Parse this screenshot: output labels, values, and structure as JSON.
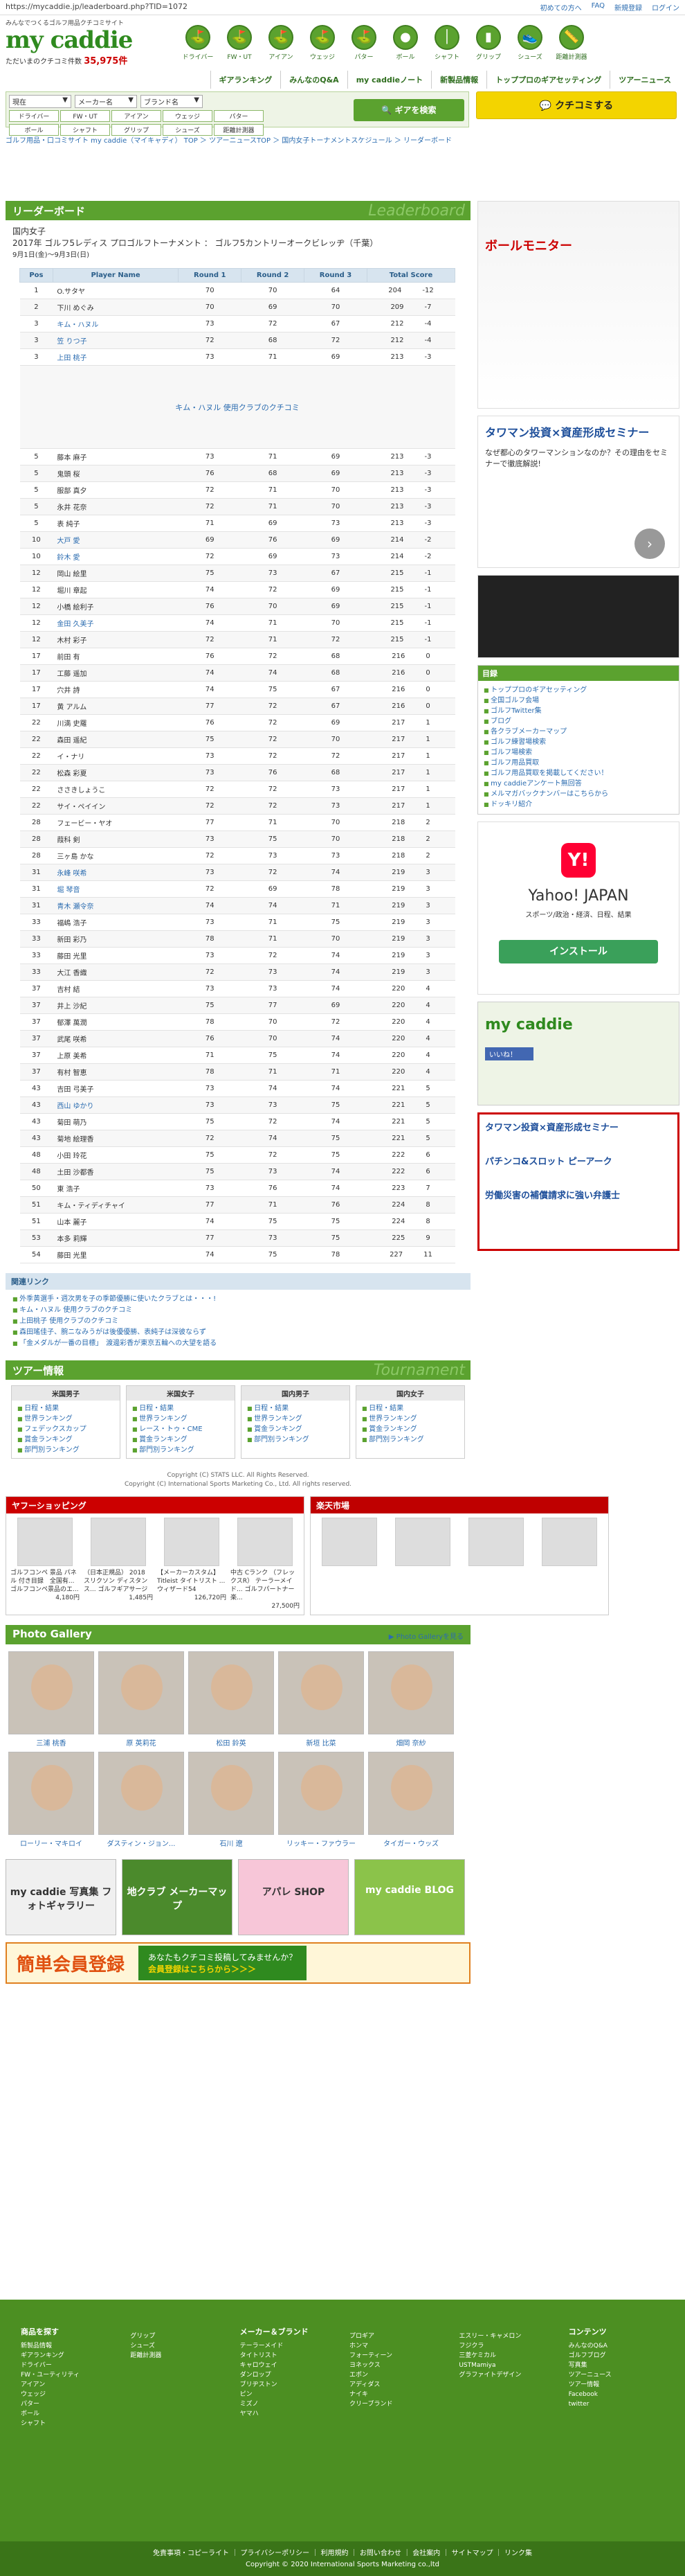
{
  "url": "https://mycaddie.jp/leaderboard.php?TID=1072",
  "top_links": [
    "初めての方へ",
    "FAQ",
    "新規登録",
    "ログイン"
  ],
  "brand": {
    "tagline": "みんなでつくるゴルフ用品クチコミサイト",
    "logo_text": "my caddie",
    "count_label": "ただいまのクチコミ件数",
    "count": "35,975件"
  },
  "categories": [
    "ドライバー",
    "FW・UT",
    "アイアン",
    "ウェッジ",
    "パター",
    "ボール",
    "シャフト",
    "グリップ",
    "シューズ",
    "距離計測器"
  ],
  "nav": [
    "ギアランキング",
    "みんなのQ&A",
    "my caddieノート",
    "新製品情報",
    "トッププロのギアセッティング",
    "ツアーニュース"
  ],
  "search": {
    "sel1": "現在",
    "sel2": "メーカー名",
    "sel3": "ブランド名",
    "chips1": [
      "ドライバー",
      "FW・UT",
      "アイアン",
      "ウェッジ",
      "パター"
    ],
    "chips2": [
      "ボール",
      "シャフト",
      "グリップ",
      "シューズ",
      "距離計測器"
    ],
    "button": "ギアを検索"
  },
  "review_button": "クチコミする",
  "breadcrumb": "ゴルフ用品・口コミサイト my caddie（マイキャディ） TOP ＞ ツアーニュースTOP ＞ 国内女子トーナメントスケジュール ＞ リーダーボード",
  "leaderboard": {
    "title": "リーダーボード",
    "ghost": "Leaderboard",
    "tour": "国内女子",
    "event": "2017年 ゴルフ5レディス プロゴルフトーナメント ： ゴルフ5カントリーオークビレッヂ（千葉）",
    "dates": "9月1日(金)～9月3日(日)",
    "cols": [
      "Pos",
      "Player Name",
      "Round 1",
      "Round 2",
      "Round 3",
      "Total Score"
    ],
    "club_note": "キム・ハヌル 使用クラブのクチコミ",
    "top": [
      [
        "1",
        "O.サタヤ",
        "70",
        "70",
        "64",
        "204",
        "-12"
      ],
      [
        "2",
        "下川 めぐみ",
        "70",
        "69",
        "70",
        "209",
        "-7"
      ],
      [
        "3",
        "キム・ハヌル",
        "73",
        "72",
        "67",
        "212",
        "-4"
      ],
      [
        "3",
        "笠 りつ子",
        "72",
        "68",
        "72",
        "212",
        "-4"
      ],
      [
        "3",
        "上田 桃子",
        "73",
        "71",
        "69",
        "213",
        "-3"
      ]
    ],
    "rest": [
      [
        "5",
        "藤本 麻子",
        "73",
        "71",
        "69",
        "213",
        "-3"
      ],
      [
        "5",
        "鬼頭 桜",
        "76",
        "68",
        "69",
        "213",
        "-3"
      ],
      [
        "5",
        "服部 真夕",
        "72",
        "71",
        "70",
        "213",
        "-3"
      ],
      [
        "5",
        "永井 花奈",
        "72",
        "71",
        "70",
        "213",
        "-3"
      ],
      [
        "5",
        "表 純子",
        "71",
        "69",
        "73",
        "213",
        "-3"
      ],
      [
        "10",
        "大戸 愛",
        "69",
        "76",
        "69",
        "214",
        "-2"
      ],
      [
        "10",
        "鈴木 愛",
        "72",
        "69",
        "73",
        "214",
        "-2"
      ],
      [
        "12",
        "岡山 絵里",
        "75",
        "73",
        "67",
        "215",
        "-1"
      ],
      [
        "12",
        "堀川 章起",
        "74",
        "72",
        "69",
        "215",
        "-1"
      ],
      [
        "12",
        "小橋 絵利子",
        "76",
        "70",
        "69",
        "215",
        "-1"
      ],
      [
        "12",
        "金田 久美子",
        "74",
        "71",
        "70",
        "215",
        "-1"
      ],
      [
        "12",
        "木村 彩子",
        "72",
        "71",
        "72",
        "215",
        "-1"
      ],
      [
        "17",
        "前田 有",
        "76",
        "72",
        "68",
        "216",
        "0"
      ],
      [
        "17",
        "工藤 遥加",
        "74",
        "74",
        "68",
        "216",
        "0"
      ],
      [
        "17",
        "穴井 詩",
        "74",
        "75",
        "67",
        "216",
        "0"
      ],
      [
        "17",
        "黄 アルム",
        "77",
        "72",
        "67",
        "216",
        "0"
      ],
      [
        "22",
        "川満 史羅",
        "76",
        "72",
        "69",
        "217",
        "1"
      ],
      [
        "22",
        "森田 遥紀",
        "75",
        "72",
        "70",
        "217",
        "1"
      ],
      [
        "22",
        "イ・ナリ",
        "73",
        "72",
        "72",
        "217",
        "1"
      ],
      [
        "22",
        "松森 彩夏",
        "73",
        "76",
        "68",
        "217",
        "1"
      ],
      [
        "22",
        "ささきしょうこ",
        "72",
        "72",
        "73",
        "217",
        "1"
      ],
      [
        "22",
        "サイ・ペイイン",
        "72",
        "72",
        "73",
        "217",
        "1"
      ],
      [
        "28",
        "フェービー・ヤオ",
        "77",
        "71",
        "70",
        "218",
        "2"
      ],
      [
        "28",
        "葭科 剣",
        "73",
        "75",
        "70",
        "218",
        "2"
      ],
      [
        "28",
        "三ヶ島 かな",
        "72",
        "73",
        "73",
        "218",
        "2"
      ],
      [
        "31",
        "永峰 咲希",
        "73",
        "72",
        "74",
        "219",
        "3"
      ],
      [
        "31",
        "堀 琴音",
        "72",
        "69",
        "78",
        "219",
        "3"
      ],
      [
        "31",
        "青木 瀬令奈",
        "74",
        "74",
        "71",
        "219",
        "3"
      ],
      [
        "33",
        "福嶋 浩子",
        "73",
        "71",
        "75",
        "219",
        "3"
      ],
      [
        "33",
        "新田 彩乃",
        "78",
        "71",
        "70",
        "219",
        "3"
      ],
      [
        "33",
        "藤田 光里",
        "73",
        "72",
        "74",
        "219",
        "3"
      ],
      [
        "33",
        "大江 香織",
        "72",
        "73",
        "74",
        "219",
        "3"
      ],
      [
        "37",
        "吉村 結",
        "73",
        "73",
        "74",
        "220",
        "4"
      ],
      [
        "37",
        "井上 沙紀",
        "75",
        "77",
        "69",
        "220",
        "4"
      ],
      [
        "37",
        "郁澤 萬潤",
        "78",
        "70",
        "72",
        "220",
        "4"
      ],
      [
        "37",
        "武尾 咲希",
        "76",
        "70",
        "74",
        "220",
        "4"
      ],
      [
        "37",
        "上原 美希",
        "71",
        "75",
        "74",
        "220",
        "4"
      ],
      [
        "37",
        "有村 智恵",
        "78",
        "71",
        "71",
        "220",
        "4"
      ],
      [
        "43",
        "吉田 弓美子",
        "73",
        "74",
        "74",
        "221",
        "5"
      ],
      [
        "43",
        "西山 ゆかり",
        "73",
        "73",
        "75",
        "221",
        "5"
      ],
      [
        "43",
        "菊田 萌乃",
        "75",
        "72",
        "74",
        "221",
        "5"
      ],
      [
        "43",
        "菊地 絵理香",
        "72",
        "74",
        "75",
        "221",
        "5"
      ],
      [
        "48",
        "小田 玲花",
        "75",
        "72",
        "75",
        "222",
        "6"
      ],
      [
        "48",
        "土田 沙都香",
        "75",
        "73",
        "74",
        "222",
        "6"
      ],
      [
        "50",
        "東 浩子",
        "73",
        "76",
        "74",
        "223",
        "7"
      ],
      [
        "51",
        "キム・ティディチャイ",
        "77",
        "71",
        "76",
        "224",
        "8"
      ],
      [
        "51",
        "山本 麗子",
        "74",
        "75",
        "75",
        "224",
        "8"
      ],
      [
        "53",
        "本多 莉輝",
        "77",
        "73",
        "75",
        "225",
        "9"
      ],
      [
        "54",
        "藤田 光里",
        "74",
        "75",
        "78",
        "227",
        "11"
      ]
    ],
    "linked_top": [
      2,
      3,
      4
    ],
    "linked_rest": [
      5,
      6,
      10,
      25,
      26,
      27,
      39
    ]
  },
  "related": {
    "title": "関連リンク",
    "items": [
      "外季黄選手・週次男を子の季節優勝に使いたクラブとは・・・!",
      "キム・ハヌル 使用クラブのクチコミ",
      "上田桃子 使用クラブのクチコミ",
      "森田瑤佳子、腕ニなみうがは後優優勝、表純子は深彼ならず",
      "「金メダルが一番の目標」　渡邊彩香が東京五輪への大望を語る"
    ]
  },
  "tour_info": {
    "title": "ツアー情報",
    "ghost": "Tournament",
    "boxes": [
      {
        "h": "米国男子",
        "items": [
          "日程・結果",
          "世界ランキング",
          "フェデックスカップ",
          "賞金ランキング",
          "部門別ランキング"
        ]
      },
      {
        "h": "米国女子",
        "items": [
          "日程・結果",
          "世界ランキング",
          "レース・トゥ・CME",
          "賞金ランキング",
          "部門別ランキング"
        ]
      },
      {
        "h": "国内男子",
        "items": [
          "日程・結果",
          "世界ランキング",
          "賞金ランキング",
          "部門別ランキング"
        ]
      },
      {
        "h": "国内女子",
        "items": [
          "日程・結果",
          "世界ランキング",
          "賞金ランキング",
          "部門別ランキング"
        ]
      }
    ]
  },
  "copyright": [
    "Copyright (C) STATS LLC. All Rights Reserved.",
    "Copyright (C) International Sports Marketing Co., Ltd. All rights reserved."
  ],
  "yahoo_shop": {
    "title": "ヤフーショッピング",
    "products": [
      {
        "n": "ゴルフコンペ 景品 パネル 付き目録　全国有... ゴルフコンペ景品のエ...",
        "p": "4,180円"
      },
      {
        "n": "（日本正規品） 2018 スリクソン ディスタンス... ゴルフギアサージ",
        "p": "1,485円"
      },
      {
        "n": "【メーカーカスタム】 Titleist タイトリスト ... ウィザード54",
        "p": "126,720円"
      },
      {
        "n": "中古 Cランク （フレックスR） テーラーメイド... ゴルフパートナー 楽...",
        "p": "27,500円"
      }
    ]
  },
  "rakuten_title": "楽天市場",
  "gallery": {
    "title": "Photo Gallery",
    "more": "Photo Galleryを見る",
    "people": [
      "三浦 桃香",
      "原 英莉花",
      "松田 鈴英",
      "新垣 比菜",
      "畑岡 奈紗",
      "ローリー・マキロイ",
      "ダスティン・ジョン...",
      "石川 遼",
      "リッキー・ファウラー",
      "タイガー・ウッズ"
    ]
  },
  "banners": [
    "my caddie 写真集 フォトギャラリー",
    "地クラブ メーカーマップ",
    "アパレ SHOP",
    "my caddie BLOG"
  ],
  "register": {
    "title": "簡単会員登録",
    "sub": "あなたもクチコミ投稿してみませんか？",
    "sub2": "会員登録はこちらから＞＞＞"
  },
  "side": {
    "ad_title": "ボールモニター",
    "ad2_title": "タワマン投資×資産形成セミナー",
    "ad2_text": "なぜ都心のタワーマンションなのか？その理由をセミナーで徹底解説!",
    "info_title": "目録",
    "links": [
      "トッププロのギアセッティング",
      "全国ゴルフ会場",
      "ゴルフTwitter集",
      "ブログ",
      "各クラブメーカーマップ",
      "ゴルフ練習場検索",
      "ゴルフ場検索",
      "ゴルフ用品買取",
      "ゴルフ用品買取を掲載してください！",
      "my caddieアンケート無回答",
      "メルマガバックナンバーはこちらから",
      "ドッキリ紹介"
    ],
    "yahoo_title": "Yahoo! JAPAN",
    "yahoo_sub": "スポーツ/政治・経済、日程、結果",
    "yahoo_btn": "インストール",
    "fb_like": "いいね！",
    "pr": [
      "タワマン投資×資産形成セミナー",
      "パチンコ&スロット ピーアーク",
      "労働災害の補償請求に強い弁護士"
    ]
  },
  "footer": {
    "cols": [
      {
        "h": "商品を探す",
        "items": [
          "新製品情報",
          "ギアランキング",
          "ドライバー",
          "FW・ユーティリティ",
          "アイアン",
          "ウェッジ",
          "パター",
          "ボール",
          "シャフト"
        ]
      },
      {
        "h": "",
        "items": [
          "グリップ",
          "シューズ",
          "距離計測器"
        ]
      },
      {
        "h": "メーカー＆ブランド",
        "items": [
          "テーラーメイド",
          "タイトリスト",
          "キャロウェイ",
          "ダンロップ",
          "ブリヂストン",
          "ピン",
          "ミズノ",
          "ヤマハ"
        ]
      },
      {
        "h": "",
        "items": [
          "プロギア",
          "ホンマ",
          "フォーティーン",
          "ヨネックス",
          "エポン",
          "アディダス",
          "ナイキ",
          "クリーブランド"
        ]
      },
      {
        "h": "",
        "items": [
          "エスリー・キャメロン",
          "フジクラ",
          "三菱ケミカル",
          "USTMamiya",
          "グラファイトデザイン"
        ]
      },
      {
        "h": "コンテンツ",
        "items": [
          "みんなのQ&A",
          "ゴルフブログ",
          "写真集",
          "ツアーニュース",
          "ツアー情報",
          "Facebook",
          "twitter"
        ]
      }
    ],
    "links": "免責事項・コピーライト ｜ プライバシーポリシー ｜ 利用規約 ｜ お問い合わせ ｜ 会社案内 ｜ サイトマップ ｜ リンク集",
    "copy": "Copyright © 2020 International Sports Marketing co.,ltd"
  }
}
